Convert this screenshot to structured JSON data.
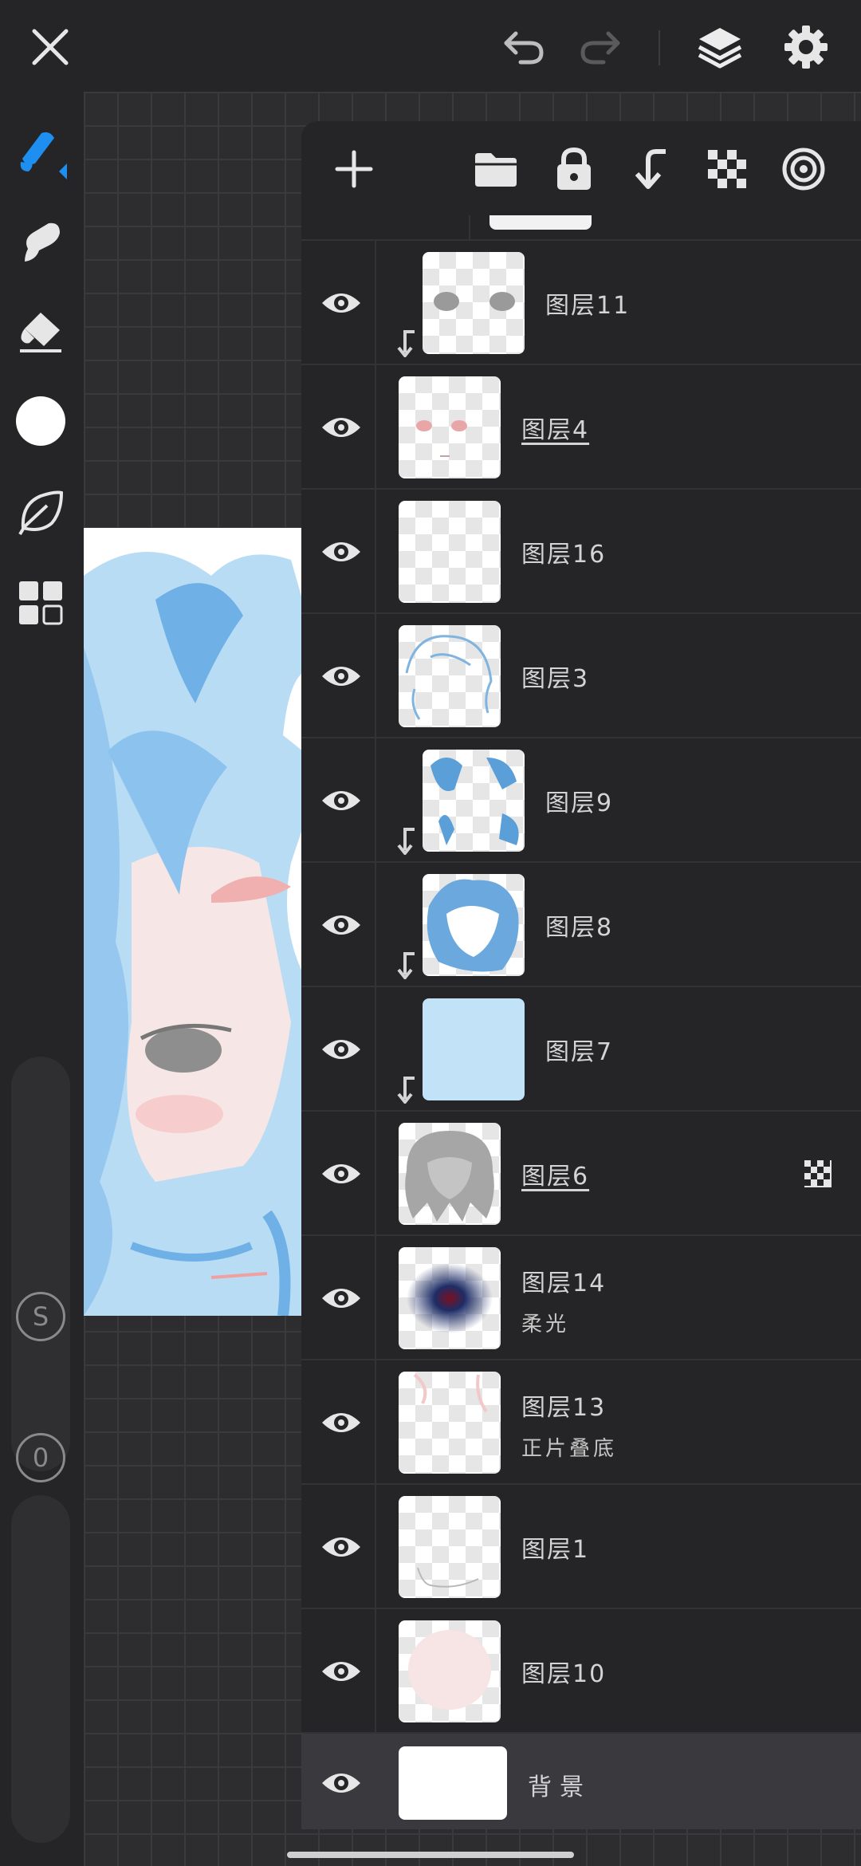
{
  "colors": {
    "accent": "#1e8ff0",
    "panel": "#252527",
    "text": "#d4d4d4"
  },
  "topbar": {
    "icons": [
      "close-icon",
      "undo-icon",
      "redo-icon",
      "layers-icon",
      "settings-icon"
    ]
  },
  "left_toolbar": {
    "tools": [
      "brush-tool-icon",
      "smudge-tool-icon",
      "eraser-tool-icon",
      "color-swatch",
      "leaf-tool-icon",
      "grid-tool-icon"
    ],
    "size_label": "S",
    "opacity_label": "0"
  },
  "layers_panel": {
    "toolbar_icons": [
      "add-layer-icon",
      "folder-icon",
      "lock-icon",
      "merge-down-icon",
      "alpha-lock-icon",
      "blend-mode-icon"
    ],
    "layers": [
      {
        "name": "图层11",
        "clipped": true,
        "underline": false,
        "mode": ""
      },
      {
        "name": "图层4",
        "clipped": false,
        "underline": true,
        "mode": ""
      },
      {
        "name": "图层16",
        "clipped": false,
        "underline": false,
        "mode": ""
      },
      {
        "name": "图层3",
        "clipped": false,
        "underline": false,
        "mode": ""
      },
      {
        "name": "图层9",
        "clipped": true,
        "underline": false,
        "mode": ""
      },
      {
        "name": "图层8",
        "clipped": true,
        "underline": false,
        "mode": ""
      },
      {
        "name": "图层7",
        "clipped": true,
        "underline": false,
        "mode": ""
      },
      {
        "name": "图层6",
        "clipped": false,
        "underline": true,
        "mode": "",
        "alpha_lock": true
      },
      {
        "name": "图层14",
        "clipped": false,
        "underline": false,
        "mode": "柔光"
      },
      {
        "name": "图层13",
        "clipped": false,
        "underline": false,
        "mode": "正片叠底"
      },
      {
        "name": "图层1",
        "clipped": false,
        "underline": false,
        "mode": ""
      },
      {
        "name": "图层10",
        "clipped": false,
        "underline": false,
        "mode": ""
      },
      {
        "name": "背景",
        "clipped": false,
        "underline": false,
        "mode": "",
        "selected": true
      }
    ]
  }
}
